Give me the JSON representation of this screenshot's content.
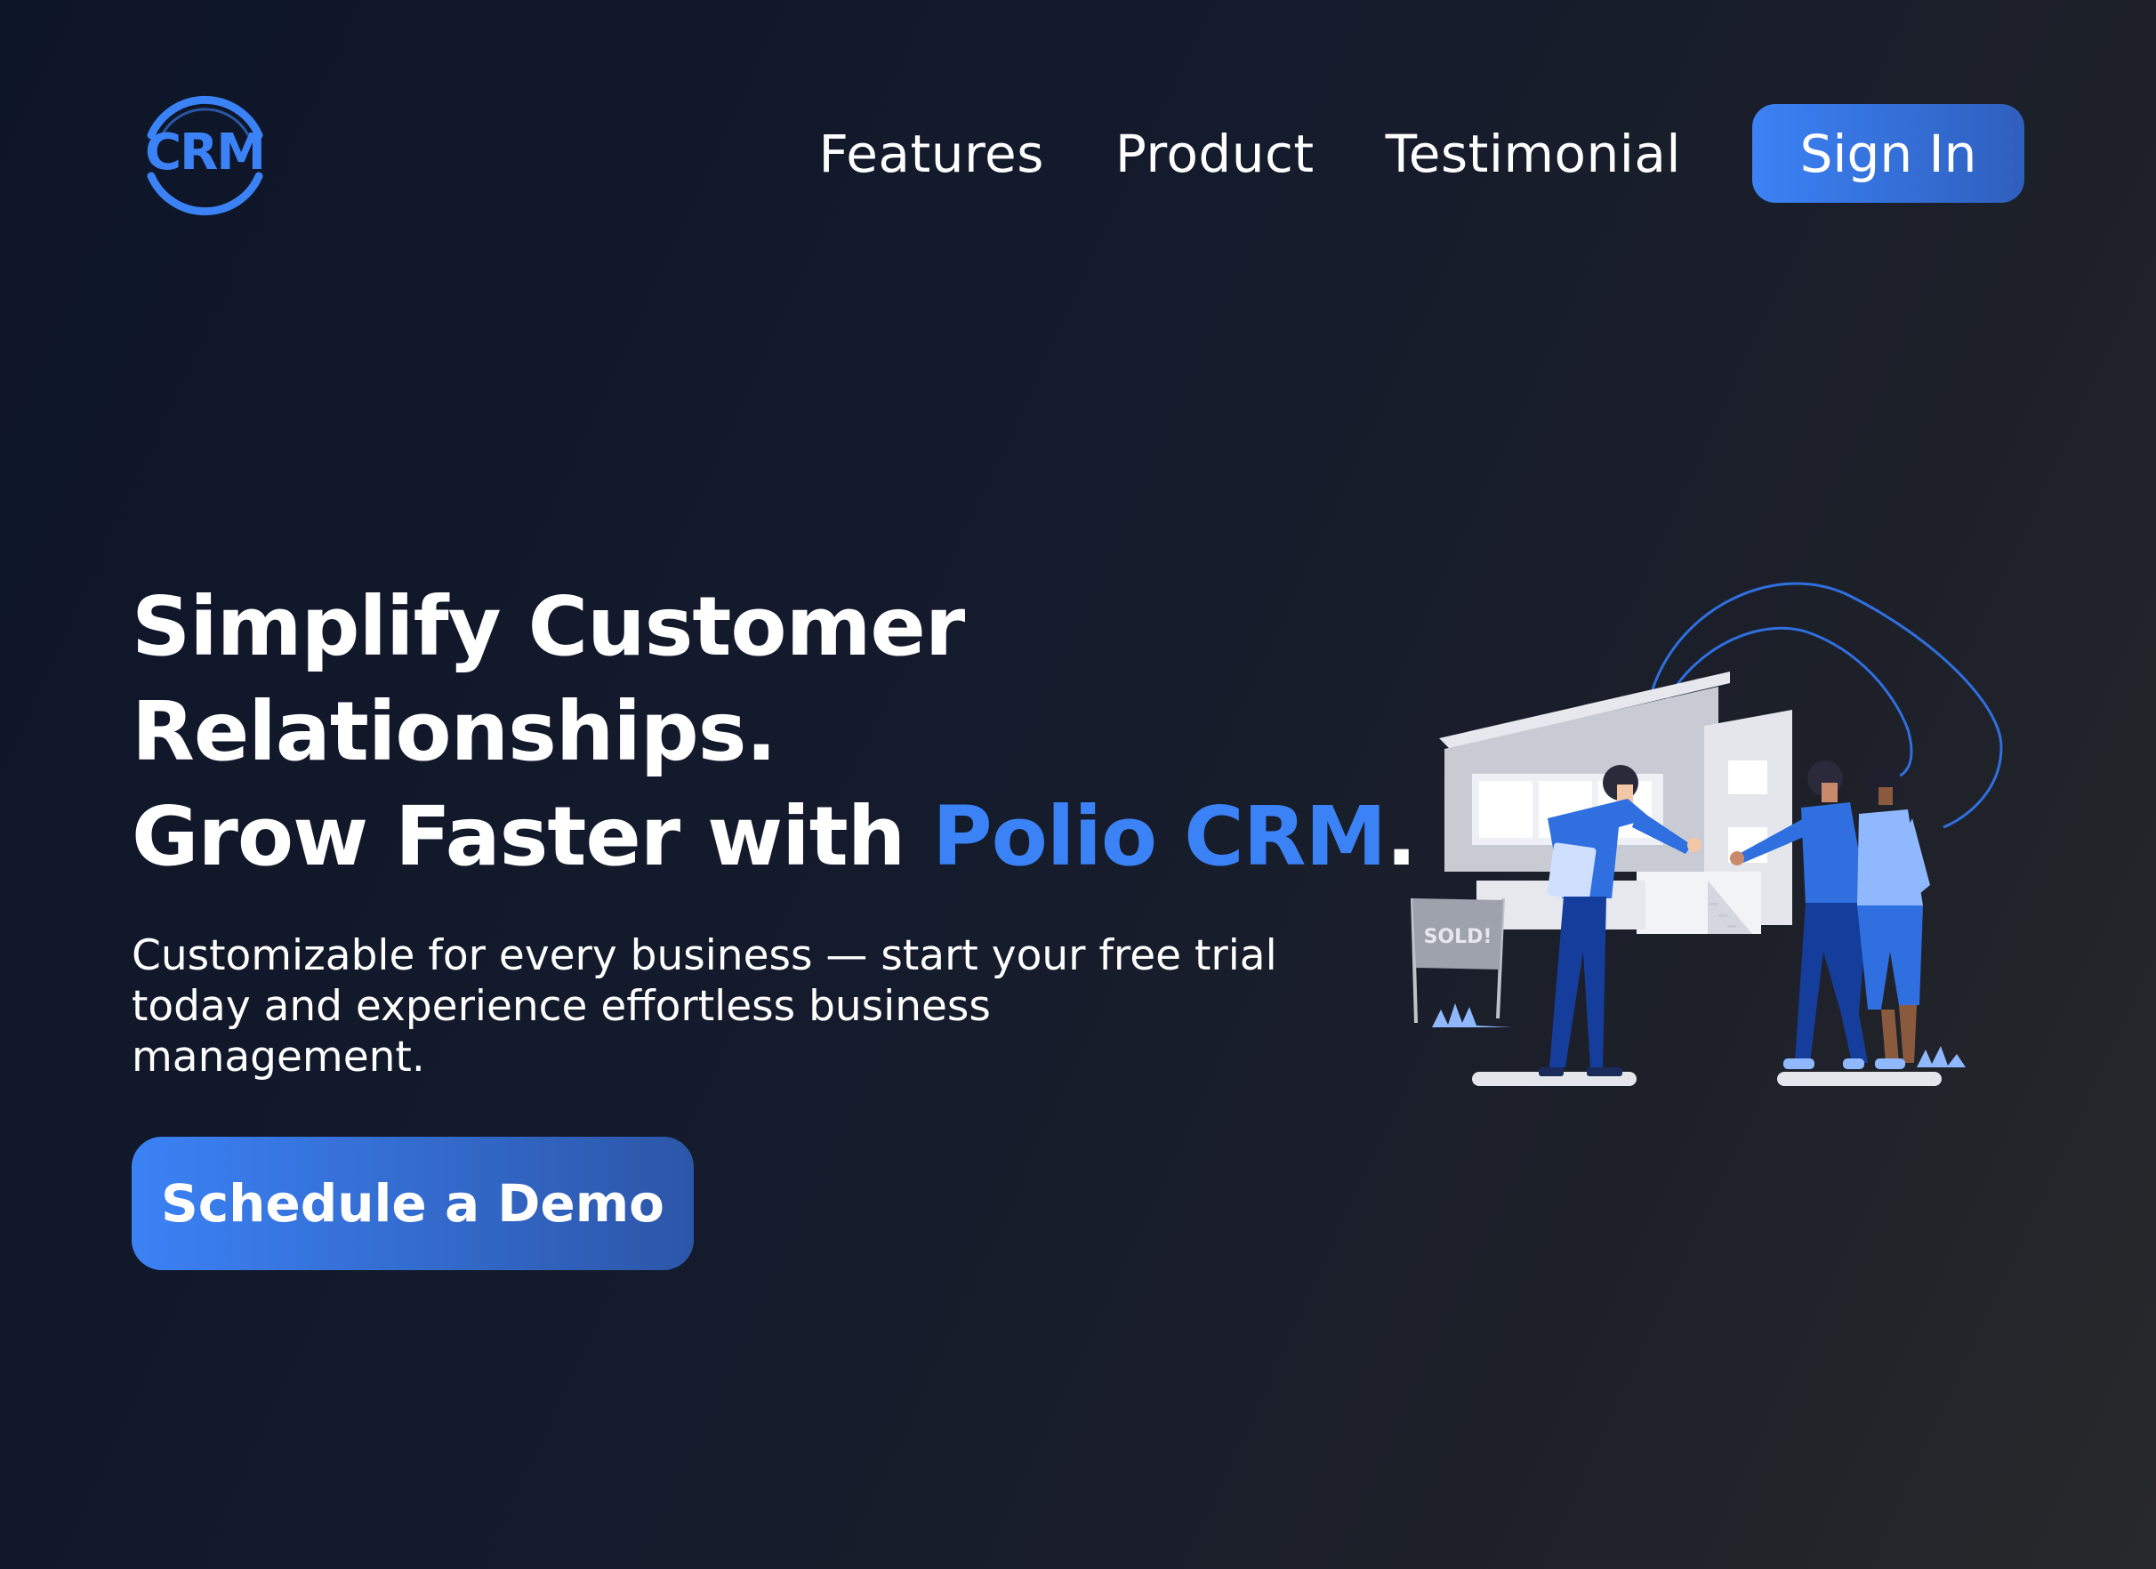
{
  "header": {
    "logo_text": "CRM",
    "nav": [
      {
        "label": "Features"
      },
      {
        "label": "Product"
      },
      {
        "label": "Testimonial"
      }
    ],
    "signin_label": "Sign In"
  },
  "hero": {
    "line1": "Simplify Customer",
    "line2": "Relationships.",
    "line3_prefix": "Grow Faster with ",
    "line3_accent": "Polio CRM",
    "line3_suffix": ".",
    "subtitle": "Customizable for every business — start your free trial today and experience effortless business management.",
    "cta_label": "Schedule a Demo",
    "sign_text": "SOLD!"
  },
  "colors": {
    "accent": "#3b82f6",
    "accent_dark": "#2c56a8",
    "background_start": "#0d1528",
    "background_end": "#28292c"
  },
  "icons": {
    "logo": "crm-logo-icon",
    "illustration": "real-estate-handshake-illustration"
  }
}
